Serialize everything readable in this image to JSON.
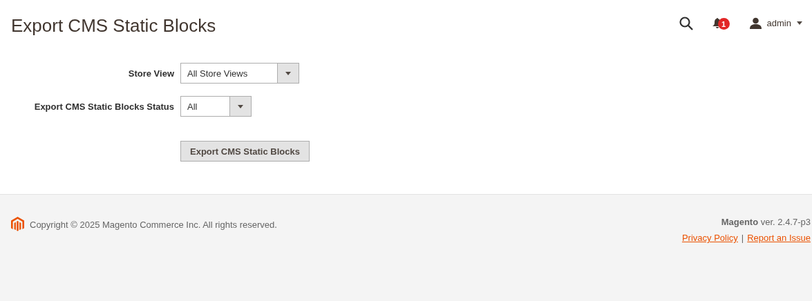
{
  "page_title": "Export CMS Static Blocks",
  "header": {
    "notification_count": "1",
    "user": "admin"
  },
  "form": {
    "fields": [
      {
        "label": "Store View",
        "value": "All Store Views",
        "kind": "select"
      },
      {
        "label": "Export CMS Static Blocks Status",
        "value": "All",
        "kind": "select"
      }
    ],
    "button": "Export CMS Static Blocks"
  },
  "footer": {
    "copyright": "Copyright © 2025 Magento Commerce Inc. All rights reserved.",
    "version": "**Magento** ver. 2.4.7-p3",
    "links": [
      "Privacy Policy",
      "Report an Issue"
    ],
    "separator": "|"
  }
}
